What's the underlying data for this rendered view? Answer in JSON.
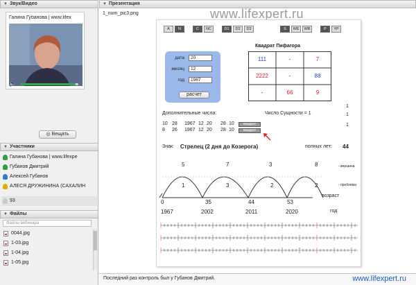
{
  "sidebar": {
    "av_panel": {
      "title": "Звук/Видео"
    },
    "video": {
      "name": "Галина Губанова | www.lifex",
      "volume_fraction": 0.95
    },
    "broadcast_label": "Вещать",
    "participants_panel": {
      "title": "Участники"
    },
    "participants": [
      {
        "name": "Галина Губанова | www.lifexpe",
        "color": "#2fa043"
      },
      {
        "name": "Губанов Дмитрий",
        "color": "#2fa043"
      },
      {
        "name": "Алексей Губанов",
        "color": "#2f7cc9"
      },
      {
        "name": "АЛЕСЯ ДРУЖИНИНА (САХАЛИН",
        "color": "#e0b000"
      }
    ],
    "participants_count": "93",
    "files_panel": {
      "title": "Файлы"
    },
    "files_search_placeholder": "Файлы вебинара",
    "files": [
      "0044.jpg",
      "1-03.jpg",
      "1-04.jpg",
      "1-05.jpg"
    ]
  },
  "presentation": {
    "panel_title": "Презентация",
    "filename": "1_num_pic3.png",
    "watermark": "www.lifexpert.ru",
    "slide": {
      "toolbar": [
        {
          "label": "A",
          "style": "light"
        },
        {
          "label": "N",
          "style": "dark"
        },
        {
          "label": "C",
          "style": "dark"
        },
        {
          "label": "NC",
          "style": "light"
        },
        {
          "label": "D1",
          "style": "dark"
        },
        {
          "label": "D2",
          "style": "light"
        },
        {
          "label": "D3",
          "style": "light"
        },
        {
          "label": "S",
          "style": "dark"
        },
        {
          "label": "WE",
          "style": "light"
        },
        {
          "label": "WB",
          "style": "light"
        },
        {
          "label": "P",
          "style": "dark"
        },
        {
          "label": "YP",
          "style": "light"
        }
      ],
      "form": {
        "day_label": "дата",
        "day_value": "20",
        "month_label": "месяц",
        "month_value": "12",
        "year_label": "год",
        "year_value": "1967",
        "calc_label": "расчет"
      },
      "pythagoras": {
        "title": "Квадрат Пифагора",
        "cells": [
          {
            "text": "111",
            "color": "blue"
          },
          {
            "text": "-",
            "color": "dark"
          },
          {
            "text": "7",
            "color": "red"
          },
          {
            "text": "2222",
            "color": "red"
          },
          {
            "text": "-",
            "color": "dark"
          },
          {
            "text": "88",
            "color": "blue"
          },
          {
            "text": "-",
            "color": "dark"
          },
          {
            "text": "66",
            "color": "red"
          },
          {
            "text": "9",
            "color": "red"
          }
        ]
      },
      "side_ones": [
        "1",
        "1",
        "1"
      ],
      "extra_numbers_label": "Дополнительные числа:",
      "essence_label": "Число Сущности = 1",
      "extra_row1": [
        "10",
        "28",
        "1967",
        "12",
        "20",
        "28",
        "10"
      ],
      "extra_row2": [
        "8",
        "26",
        "1967",
        "12",
        "20",
        "28",
        "10"
      ],
      "square_btn": "квадрат",
      "sign_label": "Знак:",
      "sign_value": "Стрелец (2 дня до Козерога)",
      "full_years_label": "полных лет:",
      "full_years_value": "44",
      "peaks_top": [
        "5",
        "7",
        "3",
        "8"
      ],
      "peaks_inner": [
        "1",
        "3",
        "2",
        "2"
      ],
      "vertex_label": "- вершина",
      "challenge_label": "- проблема",
      "axis_numbers": [
        "0",
        "35",
        "44",
        "53"
      ],
      "axis_years": [
        "1967",
        "2002",
        "2011",
        "2020"
      ],
      "age_label": "возраст",
      "year_label": "год"
    }
  },
  "status": {
    "text": "Последний раз контроль был у Губанов Дмитрий.",
    "url": "www.lifexpert.ru"
  }
}
